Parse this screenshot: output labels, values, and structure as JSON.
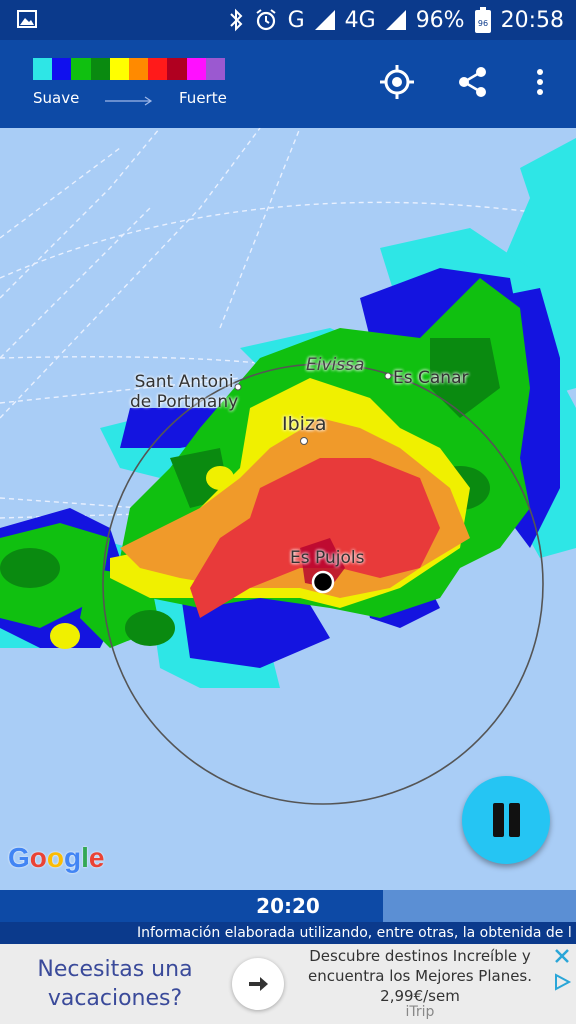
{
  "status_bar": {
    "network": "G",
    "network2": "4G",
    "battery_percent": "96%",
    "battery_level": "96",
    "time": "20:58"
  },
  "app_bar": {
    "legend_colors": [
      "#2ee6e6",
      "#1010ee",
      "#10c010",
      "#0a8a10",
      "#ffff00",
      "#ff8a00",
      "#ff1a1a",
      "#b00020",
      "#ff10ff",
      "#9b59d0"
    ],
    "legend_low_label": "Suave",
    "legend_high_label": "Fuerte",
    "icons": [
      "locate-icon",
      "share-icon",
      "more-vert-icon"
    ]
  },
  "map": {
    "labels": {
      "eivissa": "Eivissa",
      "es_canar": "Es Canar",
      "sant_antoni": "Sant Antoni\nde Portmany",
      "ibiza": "Ibiza",
      "es_pujols": "Es Pujols"
    },
    "google_logo": "Google"
  },
  "playback": {
    "time": "20:20",
    "progress": 0.665
  },
  "info_text": "Información elaborada utilizando, entre otras, la obtenida de l",
  "ad": {
    "left_text": "Necesitas una vacaciones?",
    "right_text": "Descubre destinos Increíble y encuentra los Mejores Planes. 2,99€/sem",
    "brand": "iTrip"
  }
}
